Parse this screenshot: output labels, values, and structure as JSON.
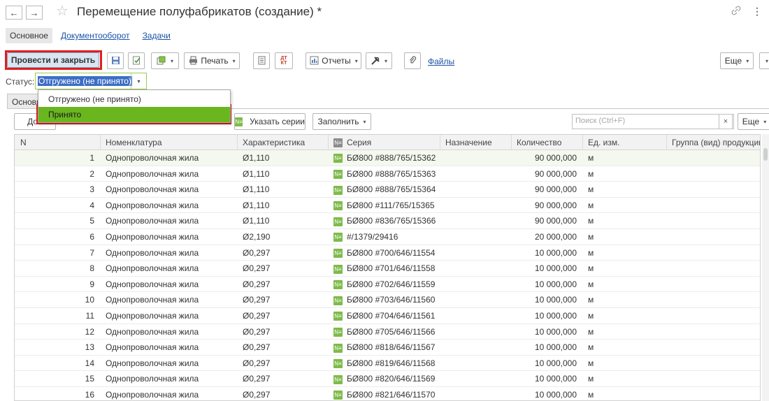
{
  "window": {
    "title": "Перемещение полуфабрикатов (создание) *",
    "back_glyph": "←",
    "forward_glyph": "→",
    "star_glyph": "☆",
    "link_glyph": "🔗",
    "more_glyph": "⋮"
  },
  "sections": [
    {
      "label": "Основное"
    },
    {
      "label": "Документооборот"
    },
    {
      "label": "Задачи"
    }
  ],
  "toolbar": {
    "post_close_label": "Провести и закрыть",
    "print_label": "Печать",
    "reports_label": "Отчеты",
    "files_label": "Файлы",
    "more_label": "Еще",
    "arrow": "▾"
  },
  "status": {
    "label": "Статус:",
    "value": "Отгружено (не принято)",
    "options": [
      "Отгружено (не принято)",
      "Принято"
    ],
    "highlighted_option": "Принято"
  },
  "tab": {
    "label": "Основн"
  },
  "table_toolbar": {
    "add_label": "Доб",
    "specify_series_label": "Указать серии",
    "fill_label": "Заполнить",
    "search_placeholder": "Поиск (Ctrl+F)",
    "clear_glyph": "×",
    "more_label": "Еще"
  },
  "table": {
    "columns": [
      "N",
      "Номенклатура",
      "Характеристика",
      "Серия",
      "Назначение",
      "Количество",
      "Ед. изм.",
      "Группа (вид) продукции"
    ],
    "rows": [
      {
        "n": "1",
        "item": "Однопроволочная жила",
        "char": "Ø1,110",
        "series": "БØ800 #888/765/15362",
        "dest": "",
        "qty": "90 000,000",
        "unit": "м",
        "group": ""
      },
      {
        "n": "2",
        "item": "Однопроволочная жила",
        "char": "Ø1,110",
        "series": "БØ800 #888/765/15363",
        "dest": "",
        "qty": "90 000,000",
        "unit": "м",
        "group": ""
      },
      {
        "n": "3",
        "item": "Однопроволочная жила",
        "char": "Ø1,110",
        "series": "БØ800 #888/765/15364",
        "dest": "",
        "qty": "90 000,000",
        "unit": "м",
        "group": ""
      },
      {
        "n": "4",
        "item": "Однопроволочная жила",
        "char": "Ø1,110",
        "series": "БØ800 #111/765/15365",
        "dest": "",
        "qty": "90 000,000",
        "unit": "м",
        "group": ""
      },
      {
        "n": "5",
        "item": "Однопроволочная жила",
        "char": "Ø1,110",
        "series": "БØ800 #836/765/15366",
        "dest": "",
        "qty": "90 000,000",
        "unit": "м",
        "group": ""
      },
      {
        "n": "6",
        "item": "Однопроволочная жила",
        "char": "Ø2,190",
        "series": "#/1379/29416",
        "dest": "",
        "qty": "20 000,000",
        "unit": "м",
        "group": ""
      },
      {
        "n": "7",
        "item": "Однопроволочная жила",
        "char": "Ø0,297",
        "series": "БØ800 #700/646/11554",
        "dest": "",
        "qty": "10 000,000",
        "unit": "м",
        "group": ""
      },
      {
        "n": "8",
        "item": "Однопроволочная жила",
        "char": "Ø0,297",
        "series": "БØ800 #701/646/11558",
        "dest": "",
        "qty": "10 000,000",
        "unit": "м",
        "group": ""
      },
      {
        "n": "9",
        "item": "Однопроволочная жила",
        "char": "Ø0,297",
        "series": "БØ800 #702/646/11559",
        "dest": "",
        "qty": "10 000,000",
        "unit": "м",
        "group": ""
      },
      {
        "n": "10",
        "item": "Однопроволочная жила",
        "char": "Ø0,297",
        "series": "БØ800 #703/646/11560",
        "dest": "",
        "qty": "10 000,000",
        "unit": "м",
        "group": ""
      },
      {
        "n": "11",
        "item": "Однопроволочная жила",
        "char": "Ø0,297",
        "series": "БØ800 #704/646/11561",
        "dest": "",
        "qty": "10 000,000",
        "unit": "м",
        "group": ""
      },
      {
        "n": "12",
        "item": "Однопроволочная жила",
        "char": "Ø0,297",
        "series": "БØ800 #705/646/11566",
        "dest": "",
        "qty": "10 000,000",
        "unit": "м",
        "group": ""
      },
      {
        "n": "13",
        "item": "Однопроволочная жила",
        "char": "Ø0,297",
        "series": "БØ800 #818/646/11567",
        "dest": "",
        "qty": "10 000,000",
        "unit": "м",
        "group": ""
      },
      {
        "n": "14",
        "item": "Однопроволочная жила",
        "char": "Ø0,297",
        "series": "БØ800 #819/646/11568",
        "dest": "",
        "qty": "10 000,000",
        "unit": "м",
        "group": ""
      },
      {
        "n": "15",
        "item": "Однопроволочная жила",
        "char": "Ø0,297",
        "series": "БØ800 #820/646/11569",
        "dest": "",
        "qty": "10 000,000",
        "unit": "м",
        "group": ""
      },
      {
        "n": "16",
        "item": "Однопроволочная жила",
        "char": "Ø0,297",
        "series": "БØ800 #821/646/11570",
        "dest": "",
        "qty": "10 000,000",
        "unit": "м",
        "group": ""
      }
    ]
  },
  "icons": [
    "back-icon",
    "forward-icon",
    "favorite-star-icon",
    "link-icon",
    "more-vertical-icon",
    "save-icon",
    "post-icon",
    "create-based-icon",
    "print-icon",
    "list-icon",
    "dt-kt-icon",
    "reports-icon",
    "tools-icon",
    "attach-icon",
    "series-icon"
  ],
  "colors": {
    "accent_red": "#e01e1e",
    "selected_green": "#6ab61f",
    "link_blue": "#1b53a6",
    "selection_blue": "#3c6ec6"
  }
}
